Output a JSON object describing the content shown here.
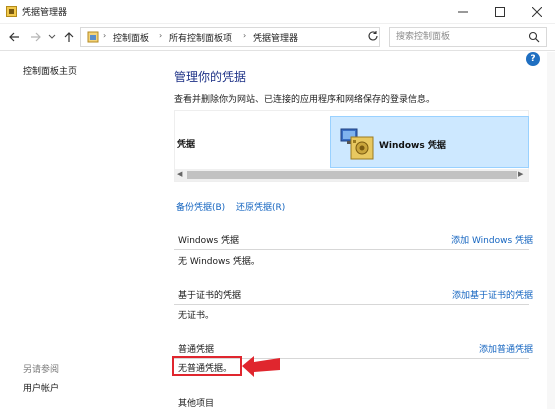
{
  "window": {
    "title": "凭据管理器"
  },
  "address": {
    "crumbs": [
      "控制面板",
      "所有控制面板项",
      "凭据管理器"
    ],
    "search_placeholder": "搜索控制面板"
  },
  "sidebar": {
    "home_link": "控制面板主页",
    "see_also_heading": "另请参阅",
    "user_accounts_link": "用户帐户"
  },
  "main": {
    "title": "管理你的凭据",
    "description": "查看并删除你为网站、已连接的应用程序和网络保存的登录信息。",
    "tabs": {
      "web_label": "凭据",
      "windows_label": "Windows 凭据"
    },
    "backup_link": "备份凭据(B)",
    "restore_link": "还原凭据(R)",
    "sections": [
      {
        "name": "Windows 凭据",
        "add": "添加 Windows 凭据",
        "empty": "无 Windows 凭据。"
      },
      {
        "name": "基于证书的凭据",
        "add": "添加基于证书的凭据",
        "empty": "无证书。"
      },
      {
        "name": "普通凭据",
        "add": "添加普通凭据",
        "empty": "无普通凭据。"
      },
      {
        "name": "其他项目"
      }
    ]
  },
  "colors": {
    "title_blue": "#1e3287",
    "link_blue": "#1565c0",
    "selected_tab_bg": "#cde8ff",
    "annotation_red": "#e0262e"
  }
}
